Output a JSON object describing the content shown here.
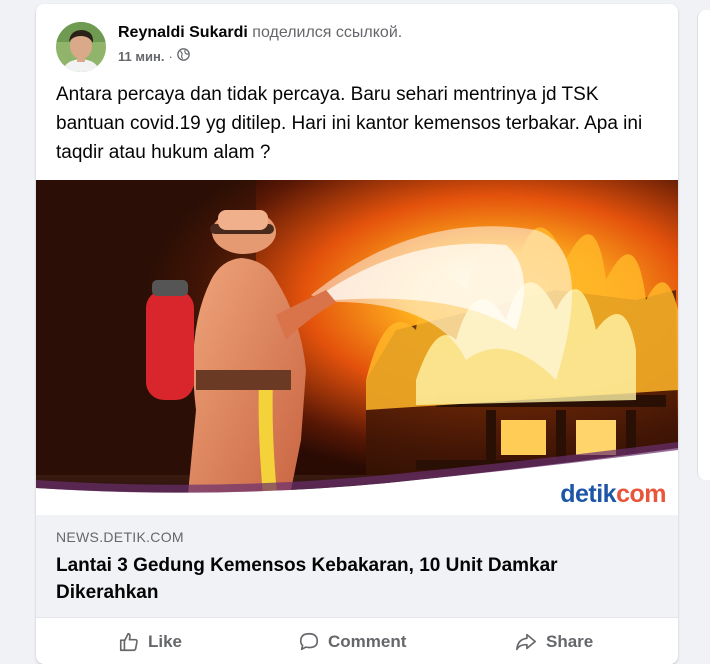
{
  "post": {
    "author_name": "Reynaldi Sukardi",
    "action_text": "поделился ссылкой.",
    "timestamp": "11 мин.",
    "separator": "·",
    "audience_icon": "globe-icon",
    "text": "Antara percaya dan tidak percaya. Baru sehari mentrinya jd TSK bantuan covid.19 yg ditilep. Hari ini kantor kemensos terbakar. Apa ini taqdir atau hukum alam ?"
  },
  "link": {
    "image_logo_main": "detik",
    "image_logo_suffix": "com",
    "domain": "NEWS.DETIK.COM",
    "title": "Lantai 3 Gedung Kemensos Kebakaran, 10 Unit Damkar Dikerahkan"
  },
  "actions": {
    "like_label": "Like",
    "like_icon": "thumbs-up-icon",
    "comment_label": "Comment",
    "comment_icon": "comment-icon",
    "share_label": "Share",
    "share_icon": "share-icon"
  },
  "colors": {
    "background": "#f0f2f5",
    "text": "#050505",
    "secondary_text": "#65676b",
    "detik_blue": "#1d56a6",
    "detik_orange": "#e8553a"
  }
}
